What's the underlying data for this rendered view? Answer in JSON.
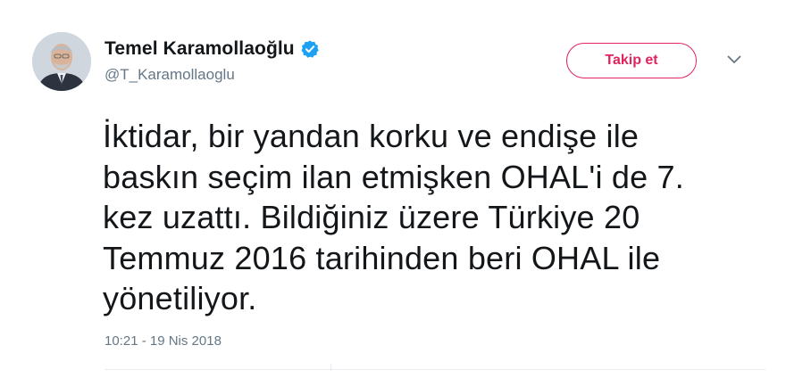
{
  "tweet": {
    "author": {
      "display_name": "Temel Karamollaoğlu",
      "handle": "@T_Karamollaoglu",
      "verified": true
    },
    "follow_button_label": "Takip et",
    "text": "İktidar, bir yandan korku ve endişe ile\nbaskın seçim ilan etmişken OHAL'i de 7.\nkez uzattı. Bildiğiniz üzere Türkiye 20\nTemmuz 2016 tarihinden beri OHAL ile\nyönetiliyor.",
    "timestamp": "10:21 - 19 Nis 2018"
  },
  "colors": {
    "follow_accent": "#e0245e",
    "verified_blue": "#1da1f2",
    "secondary_text": "#657786",
    "primary_text": "#14171a"
  },
  "icons": {
    "verified": "verified-badge-icon",
    "caret": "chevron-down-icon"
  }
}
